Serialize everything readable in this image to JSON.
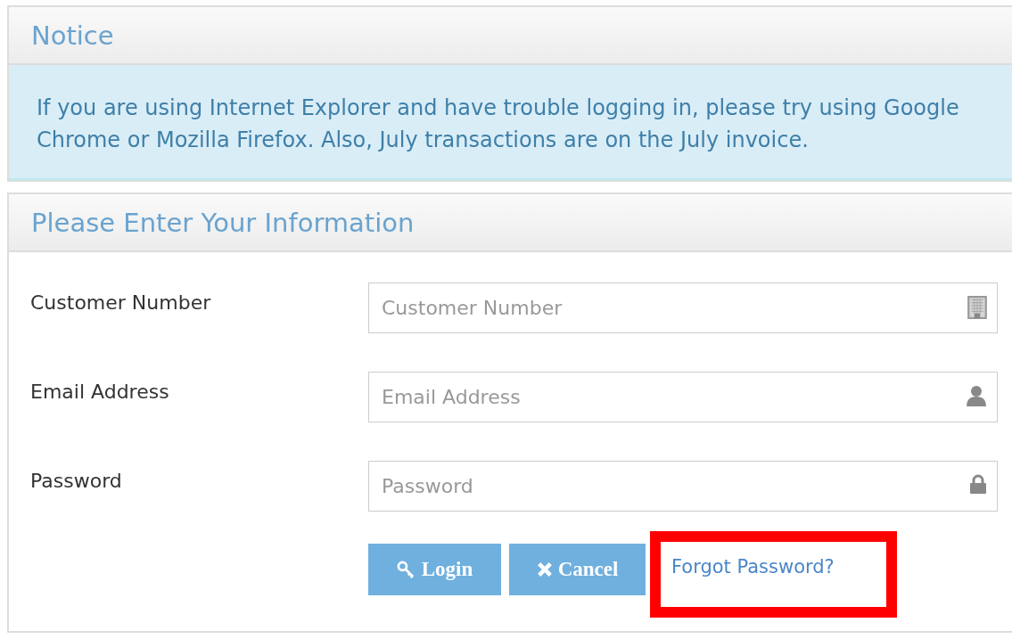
{
  "notice": {
    "title": "Notice",
    "text": "If you are using Internet Explorer and have trouble logging in, please try using Google Chrome or Mozilla Firefox. Also, July transactions are on the July invoice."
  },
  "form": {
    "title": "Please Enter Your Information",
    "fields": [
      {
        "label": "Customer Number",
        "placeholder": "Customer Number",
        "kind": "building"
      },
      {
        "label": "Email Address",
        "placeholder": "Email Address",
        "kind": "user"
      },
      {
        "label": "Password",
        "placeholder": "Password",
        "kind": "lock"
      }
    ],
    "buttons": [
      {
        "label": "Login",
        "kind": "key"
      },
      {
        "label": "Cancel",
        "kind": "cross"
      }
    ],
    "link": {
      "label": "Forgot Password?",
      "highlighted": true
    }
  }
}
